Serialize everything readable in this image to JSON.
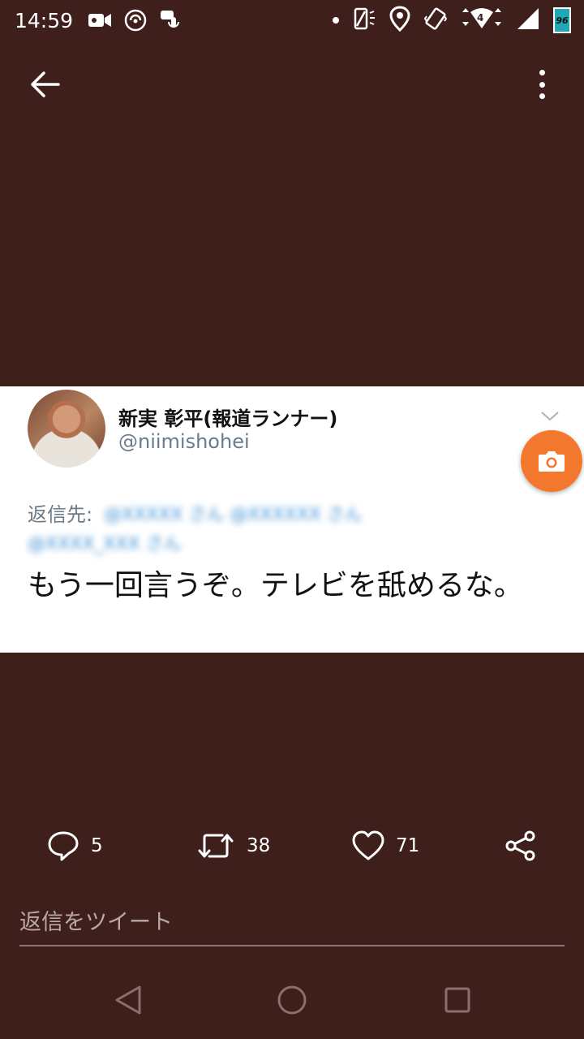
{
  "status_bar": {
    "time": "14:59",
    "battery_level": "96",
    "signal_label": "4"
  },
  "tweet": {
    "author_name": "新実 彰平(報道ランナー)",
    "author_handle": "@niimishohei",
    "reply_to_label": "返信先:",
    "reply_to_blurred_1": "@XXXXX さん @XXXXXX さん",
    "reply_to_blurred_2": "@XXXX_XXX さん",
    "text": "もう一回言うぞ。テレビを舐めるな。"
  },
  "actions": {
    "reply_count": "5",
    "retweet_count": "38",
    "like_count": "71"
  },
  "reply_input": {
    "placeholder": "返信をツイート"
  },
  "colors": {
    "background": "#3f1f1c",
    "camera_button": "#f3782e",
    "battery": "#21a8b4"
  }
}
